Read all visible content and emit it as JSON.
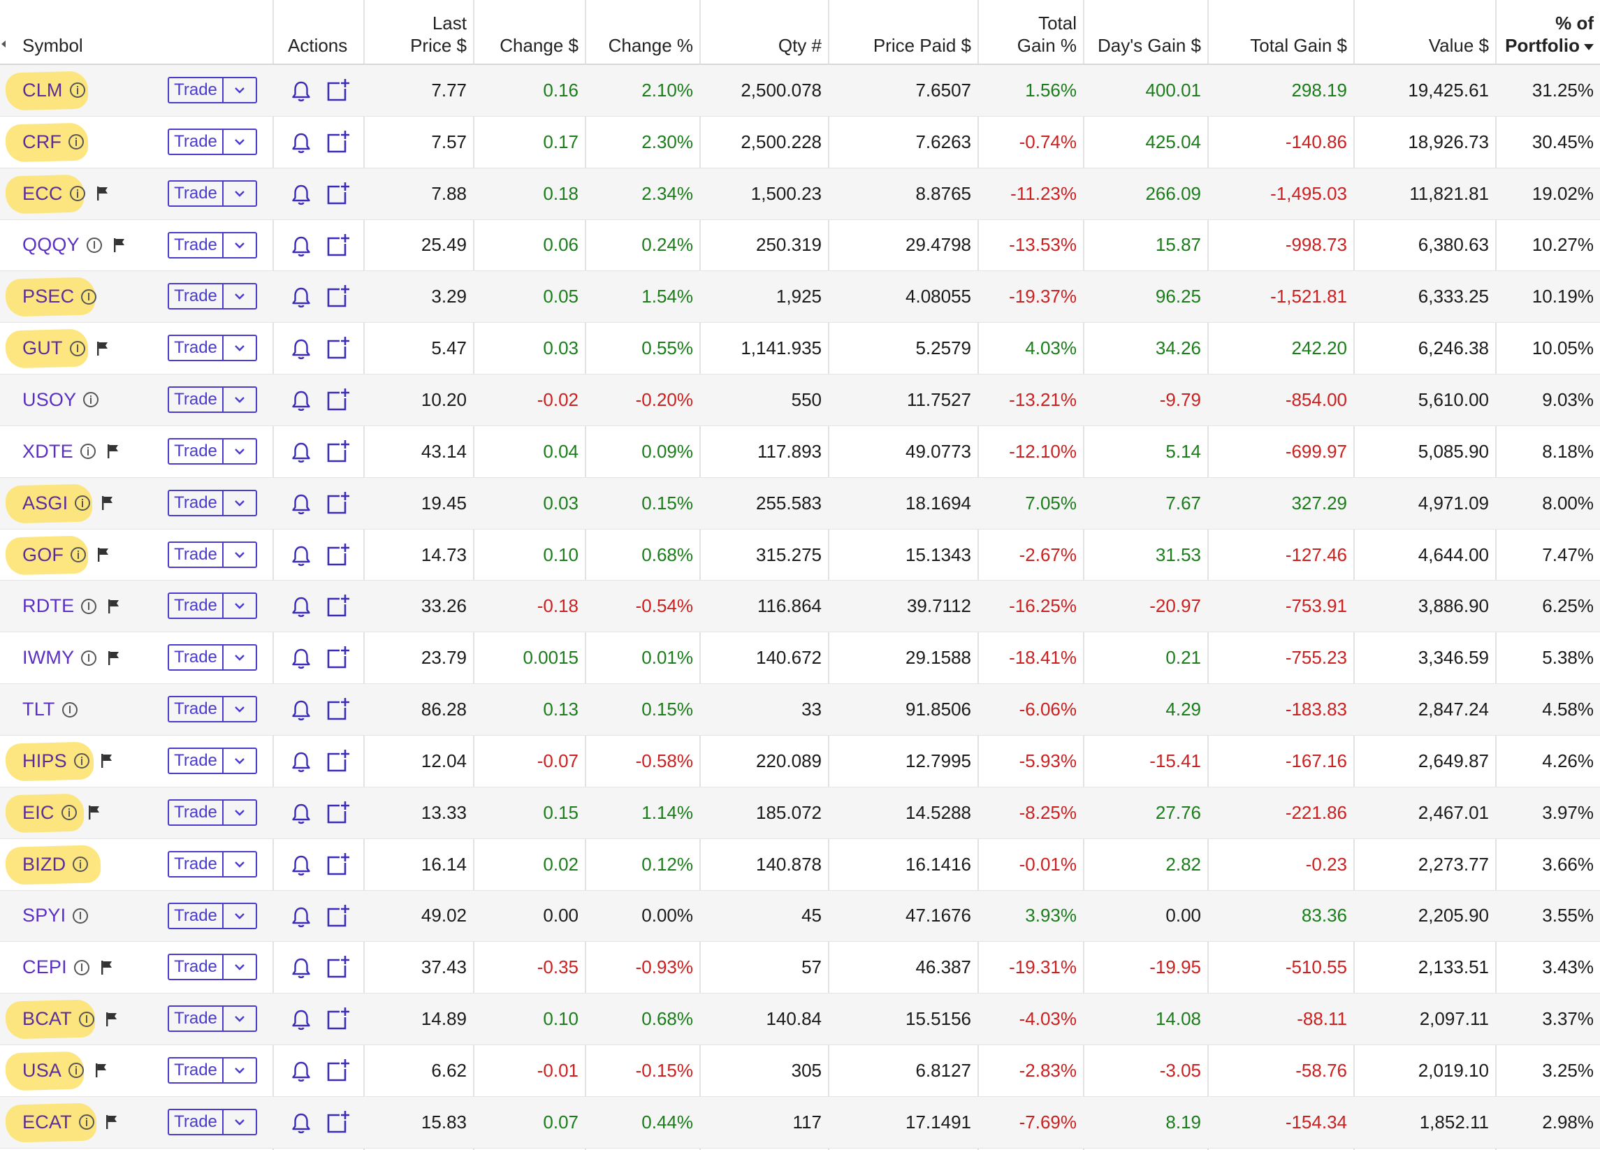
{
  "headers": {
    "symbol": "Symbol",
    "actions": "Actions",
    "last_price_1": "Last",
    "last_price_2": "Price $",
    "change_usd": "Change $",
    "change_pct": "Change %",
    "qty": "Qty #",
    "price_paid": "Price Paid $",
    "total_gain_pct_1": "Total",
    "total_gain_pct_2": "Gain %",
    "days_gain": "Day's Gain $",
    "total_gain_usd": "Total Gain $",
    "value": "Value $",
    "portfolio_1": "% of",
    "portfolio_2": "Portfolio"
  },
  "trade_label": "Trade",
  "colors": {
    "positive": "#1a7d1a",
    "negative": "#cc1f1f",
    "link": "#5a2fc4",
    "highlight": "#fde268"
  },
  "rows": [
    {
      "symbol": "CLM",
      "highlight": true,
      "flag": false,
      "last": "7.77",
      "chg": "0.16",
      "chgp": "2.10%",
      "qty": "2,500.078",
      "paid": "7.6507",
      "tgp": "1.56%",
      "dg": "400.01",
      "tg": "298.19",
      "value": "19,425.61",
      "pct": "31.25%",
      "s_chg": "pos",
      "s_tgp": "pos",
      "s_dg": "pos",
      "s_tg": "pos"
    },
    {
      "symbol": "CRF",
      "highlight": true,
      "flag": false,
      "last": "7.57",
      "chg": "0.17",
      "chgp": "2.30%",
      "qty": "2,500.228",
      "paid": "7.6263",
      "tgp": "-0.74%",
      "dg": "425.04",
      "tg": "-140.86",
      "value": "18,926.73",
      "pct": "30.45%",
      "s_chg": "pos",
      "s_tgp": "neg",
      "s_dg": "pos",
      "s_tg": "neg"
    },
    {
      "symbol": "ECC",
      "highlight": true,
      "flag": true,
      "last": "7.88",
      "chg": "0.18",
      "chgp": "2.34%",
      "qty": "1,500.23",
      "paid": "8.8765",
      "tgp": "-11.23%",
      "dg": "266.09",
      "tg": "-1,495.03",
      "value": "11,821.81",
      "pct": "19.02%",
      "s_chg": "pos",
      "s_tgp": "neg",
      "s_dg": "pos",
      "s_tg": "neg"
    },
    {
      "symbol": "QQQY",
      "highlight": false,
      "flag": true,
      "last": "25.49",
      "chg": "0.06",
      "chgp": "0.24%",
      "qty": "250.319",
      "paid": "29.4798",
      "tgp": "-13.53%",
      "dg": "15.87",
      "tg": "-998.73",
      "value": "6,380.63",
      "pct": "10.27%",
      "s_chg": "pos",
      "s_tgp": "neg",
      "s_dg": "pos",
      "s_tg": "neg"
    },
    {
      "symbol": "PSEC",
      "highlight": true,
      "flag": false,
      "last": "3.29",
      "chg": "0.05",
      "chgp": "1.54%",
      "qty": "1,925",
      "paid": "4.08055",
      "tgp": "-19.37%",
      "dg": "96.25",
      "tg": "-1,521.81",
      "value": "6,333.25",
      "pct": "10.19%",
      "s_chg": "pos",
      "s_tgp": "neg",
      "s_dg": "pos",
      "s_tg": "neg"
    },
    {
      "symbol": "GUT",
      "highlight": true,
      "flag": true,
      "last": "5.47",
      "chg": "0.03",
      "chgp": "0.55%",
      "qty": "1,141.935",
      "paid": "5.2579",
      "tgp": "4.03%",
      "dg": "34.26",
      "tg": "242.20",
      "value": "6,246.38",
      "pct": "10.05%",
      "s_chg": "pos",
      "s_tgp": "pos",
      "s_dg": "pos",
      "s_tg": "pos"
    },
    {
      "symbol": "USOY",
      "highlight": false,
      "flag": false,
      "last": "10.20",
      "chg": "-0.02",
      "chgp": "-0.20%",
      "qty": "550",
      "paid": "11.7527",
      "tgp": "-13.21%",
      "dg": "-9.79",
      "tg": "-854.00",
      "value": "5,610.00",
      "pct": "9.03%",
      "s_chg": "neg",
      "s_tgp": "neg",
      "s_dg": "neg",
      "s_tg": "neg"
    },
    {
      "symbol": "XDTE",
      "highlight": false,
      "flag": true,
      "last": "43.14",
      "chg": "0.04",
      "chgp": "0.09%",
      "qty": "117.893",
      "paid": "49.0773",
      "tgp": "-12.10%",
      "dg": "5.14",
      "tg": "-699.97",
      "value": "5,085.90",
      "pct": "8.18%",
      "s_chg": "pos",
      "s_tgp": "neg",
      "s_dg": "pos",
      "s_tg": "neg"
    },
    {
      "symbol": "ASGI",
      "highlight": true,
      "flag": true,
      "last": "19.45",
      "chg": "0.03",
      "chgp": "0.15%",
      "qty": "255.583",
      "paid": "18.1694",
      "tgp": "7.05%",
      "dg": "7.67",
      "tg": "327.29",
      "value": "4,971.09",
      "pct": "8.00%",
      "s_chg": "pos",
      "s_tgp": "pos",
      "s_dg": "pos",
      "s_tg": "pos"
    },
    {
      "symbol": "GOF",
      "highlight": true,
      "flag": true,
      "last": "14.73",
      "chg": "0.10",
      "chgp": "0.68%",
      "qty": "315.275",
      "paid": "15.1343",
      "tgp": "-2.67%",
      "dg": "31.53",
      "tg": "-127.46",
      "value": "4,644.00",
      "pct": "7.47%",
      "s_chg": "pos",
      "s_tgp": "neg",
      "s_dg": "pos",
      "s_tg": "neg"
    },
    {
      "symbol": "RDTE",
      "highlight": false,
      "flag": true,
      "last": "33.26",
      "chg": "-0.18",
      "chgp": "-0.54%",
      "qty": "116.864",
      "paid": "39.7112",
      "tgp": "-16.25%",
      "dg": "-20.97",
      "tg": "-753.91",
      "value": "3,886.90",
      "pct": "6.25%",
      "s_chg": "neg",
      "s_tgp": "neg",
      "s_dg": "neg",
      "s_tg": "neg"
    },
    {
      "symbol": "IWMY",
      "highlight": false,
      "flag": true,
      "last": "23.79",
      "chg": "0.0015",
      "chgp": "0.01%",
      "qty": "140.672",
      "paid": "29.1588",
      "tgp": "-18.41%",
      "dg": "0.21",
      "tg": "-755.23",
      "value": "3,346.59",
      "pct": "5.38%",
      "s_chg": "pos",
      "s_tgp": "neg",
      "s_dg": "pos",
      "s_tg": "neg"
    },
    {
      "symbol": "TLT",
      "highlight": false,
      "flag": false,
      "last": "86.28",
      "chg": "0.13",
      "chgp": "0.15%",
      "qty": "33",
      "paid": "91.8506",
      "tgp": "-6.06%",
      "dg": "4.29",
      "tg": "-183.83",
      "value": "2,847.24",
      "pct": "4.58%",
      "s_chg": "pos",
      "s_tgp": "neg",
      "s_dg": "pos",
      "s_tg": "neg"
    },
    {
      "symbol": "HIPS",
      "highlight": true,
      "flag": true,
      "last": "12.04",
      "chg": "-0.07",
      "chgp": "-0.58%",
      "qty": "220.089",
      "paid": "12.7995",
      "tgp": "-5.93%",
      "dg": "-15.41",
      "tg": "-167.16",
      "value": "2,649.87",
      "pct": "4.26%",
      "s_chg": "neg",
      "s_tgp": "neg",
      "s_dg": "neg",
      "s_tg": "neg"
    },
    {
      "symbol": "EIC",
      "highlight": true,
      "flag": true,
      "last": "13.33",
      "chg": "0.15",
      "chgp": "1.14%",
      "qty": "185.072",
      "paid": "14.5288",
      "tgp": "-8.25%",
      "dg": "27.76",
      "tg": "-221.86",
      "value": "2,467.01",
      "pct": "3.97%",
      "s_chg": "pos",
      "s_tgp": "neg",
      "s_dg": "pos",
      "s_tg": "neg"
    },
    {
      "symbol": "BIZD",
      "highlight": true,
      "flag": false,
      "last": "16.14",
      "chg": "0.02",
      "chgp": "0.12%",
      "qty": "140.878",
      "paid": "16.1416",
      "tgp": "-0.01%",
      "dg": "2.82",
      "tg": "-0.23",
      "value": "2,273.77",
      "pct": "3.66%",
      "s_chg": "pos",
      "s_tgp": "neg",
      "s_dg": "pos",
      "s_tg": "neg"
    },
    {
      "symbol": "SPYI",
      "highlight": false,
      "flag": false,
      "last": "49.02",
      "chg": "0.00",
      "chgp": "0.00%",
      "qty": "45",
      "paid": "47.1676",
      "tgp": "3.93%",
      "dg": "0.00",
      "tg": "83.36",
      "value": "2,205.90",
      "pct": "3.55%",
      "s_chg": "neu",
      "s_tgp": "pos",
      "s_dg": "neu",
      "s_tg": "pos"
    },
    {
      "symbol": "CEPI",
      "highlight": false,
      "flag": true,
      "last": "37.43",
      "chg": "-0.35",
      "chgp": "-0.93%",
      "qty": "57",
      "paid": "46.387",
      "tgp": "-19.31%",
      "dg": "-19.95",
      "tg": "-510.55",
      "value": "2,133.51",
      "pct": "3.43%",
      "s_chg": "neg",
      "s_tgp": "neg",
      "s_dg": "neg",
      "s_tg": "neg"
    },
    {
      "symbol": "BCAT",
      "highlight": true,
      "flag": true,
      "last": "14.89",
      "chg": "0.10",
      "chgp": "0.68%",
      "qty": "140.84",
      "paid": "15.5156",
      "tgp": "-4.03%",
      "dg": "14.08",
      "tg": "-88.11",
      "value": "2,097.11",
      "pct": "3.37%",
      "s_chg": "pos",
      "s_tgp": "neg",
      "s_dg": "pos",
      "s_tg": "neg"
    },
    {
      "symbol": "USA",
      "highlight": true,
      "flag": true,
      "last": "6.62",
      "chg": "-0.01",
      "chgp": "-0.15%",
      "qty": "305",
      "paid": "6.8127",
      "tgp": "-2.83%",
      "dg": "-3.05",
      "tg": "-58.76",
      "value": "2,019.10",
      "pct": "3.25%",
      "s_chg": "neg",
      "s_tgp": "neg",
      "s_dg": "neg",
      "s_tg": "neg"
    },
    {
      "symbol": "ECAT",
      "highlight": true,
      "flag": true,
      "last": "15.83",
      "chg": "0.07",
      "chgp": "0.44%",
      "qty": "117",
      "paid": "17.1491",
      "tgp": "-7.69%",
      "dg": "8.19",
      "tg": "-154.34",
      "value": "1,852.11",
      "pct": "2.98%",
      "s_chg": "pos",
      "s_tgp": "neg",
      "s_dg": "pos",
      "s_tg": "neg"
    }
  ]
}
